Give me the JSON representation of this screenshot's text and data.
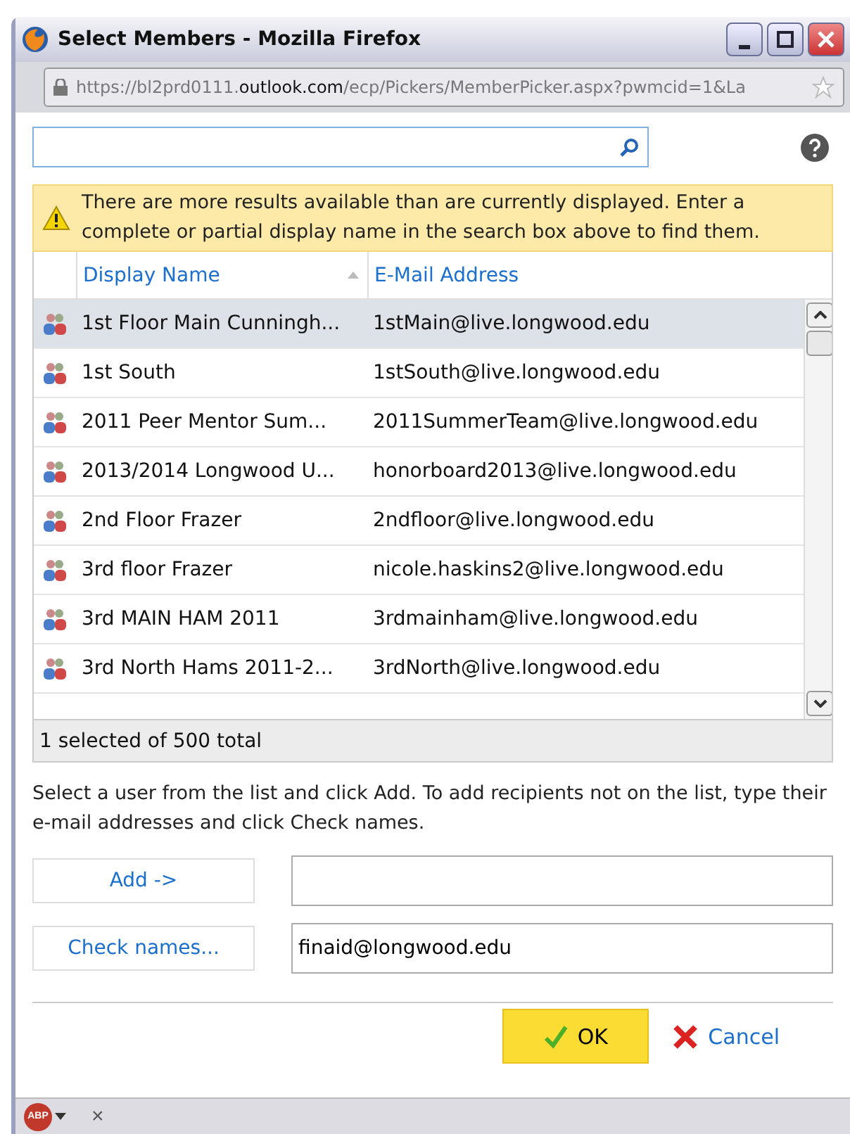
{
  "window": {
    "title": "Select Members - Mozilla Firefox"
  },
  "address_bar": {
    "prefix": "https://bl2prd0111.",
    "domain": "outlook.com",
    "path": "/ecp/Pickers/MemberPicker.aspx?pwmcid=1&La"
  },
  "notice": "There are more results available than are currently displayed. Enter a complete or partial display name in the search box above to find them.",
  "table": {
    "columns": [
      "Display Name",
      "E-Mail Address"
    ],
    "rows": [
      {
        "name": "1st Floor Main Cunningh...",
        "email": "1stMain@live.longwood.edu",
        "selected": true
      },
      {
        "name": "1st South",
        "email": "1stSouth@live.longwood.edu",
        "selected": false
      },
      {
        "name": "2011 Peer Mentor Sum...",
        "email": "2011SummerTeam@live.longwood.edu",
        "selected": false
      },
      {
        "name": "2013/2014 Longwood U...",
        "email": "honorboard2013@live.longwood.edu",
        "selected": false
      },
      {
        "name": "2nd Floor Frazer",
        "email": "2ndfloor@live.longwood.edu",
        "selected": false
      },
      {
        "name": "3rd floor Frazer",
        "email": "nicole.haskins2@live.longwood.edu",
        "selected": false
      },
      {
        "name": "3rd MAIN HAM 2011",
        "email": "3rdmainham@live.longwood.edu",
        "selected": false
      },
      {
        "name": "3rd North Hams 2011-2...",
        "email": "3rdNorth@live.longwood.edu",
        "selected": false
      }
    ]
  },
  "status": "1 selected of 500 total",
  "instructions": "Select a user from the list and click Add. To add recipients not on the list, type their e-mail addresses and click Check names.",
  "add": {
    "button": "Add ->"
  },
  "check": {
    "button": "Check names...",
    "value": "finaid@longwood.edu"
  },
  "buttons": {
    "ok": "OK",
    "cancel": "Cancel"
  },
  "addon_bar": {
    "logo": "ABP",
    "close": "×"
  }
}
